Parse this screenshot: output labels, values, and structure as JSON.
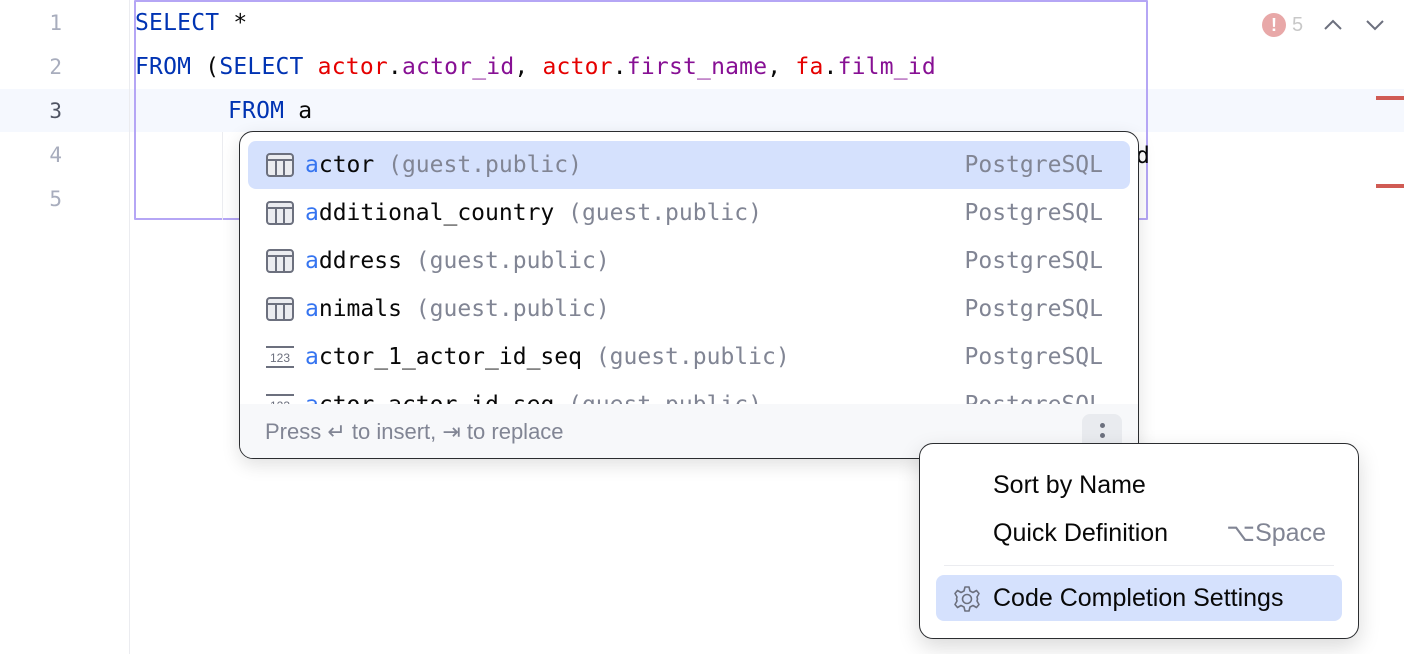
{
  "editor": {
    "line_numbers": [
      "1",
      "2",
      "3",
      "4",
      "5"
    ],
    "current_line": "3",
    "code": {
      "line1": {
        "kw": "SELECT",
        "rest": " *"
      },
      "line2": {
        "kw1": "FROM",
        "paren": " (",
        "kw2": "SELECT",
        "t1": "actor",
        "c1": "actor_id",
        "t2": "actor",
        "c2": "first_name",
        "t3": "fa",
        "c3": "film_id"
      },
      "line3": {
        "kw": "FROM",
        "typed": " a"
      },
      "line4_tail": "d"
    },
    "inspection": {
      "error_icon": "error-icon",
      "error_count": "5",
      "prev_icon": "chevron-up-icon",
      "next_icon": "chevron-down-icon"
    }
  },
  "completion": {
    "items": [
      {
        "icon": "table-icon",
        "match": "a",
        "rest": "ctor",
        "location": " (guest.public)",
        "source": "PostgreSQL",
        "selected": true
      },
      {
        "icon": "table-icon",
        "match": "a",
        "rest": "dditional_country",
        "location": " (guest.public)",
        "source": "PostgreSQL",
        "selected": false
      },
      {
        "icon": "table-icon",
        "match": "a",
        "rest": "ddress",
        "location": " (guest.public)",
        "source": "PostgreSQL",
        "selected": false
      },
      {
        "icon": "table-icon",
        "match": "a",
        "rest": "nimals",
        "location": " (guest.public)",
        "source": "PostgreSQL",
        "selected": false
      },
      {
        "icon": "sequence-icon",
        "match": "a",
        "rest": "ctor_1_actor_id_seq",
        "location": " (guest.public)",
        "source": "PostgreSQL",
        "selected": false
      },
      {
        "icon": "sequence-icon",
        "match": "a",
        "rest": "ctor_actor_id_seq",
        "location": " (guest.public)",
        "source": "PostgreSQL",
        "selected": false
      }
    ],
    "footer_hint": "Press ↵ to insert, ⇥ to replace",
    "more_icon": "more-vertical-icon"
  },
  "menu": {
    "items": [
      {
        "label": "Sort by Name",
        "shortcut": ""
      },
      {
        "label": "Quick Definition",
        "shortcut": "⌥Space"
      },
      {
        "label": "Code Completion Settings",
        "shortcut": "",
        "icon": "gear-icon",
        "selected": true
      }
    ]
  },
  "colors": {
    "keyword": "#0033b3",
    "table_ref": "#e50000",
    "column_ref": "#871094",
    "match_highlight": "#3574f0",
    "selection": "#d5e1fd",
    "fragment_border": "#b5a6f5",
    "error_stripe": "#d05b54"
  }
}
